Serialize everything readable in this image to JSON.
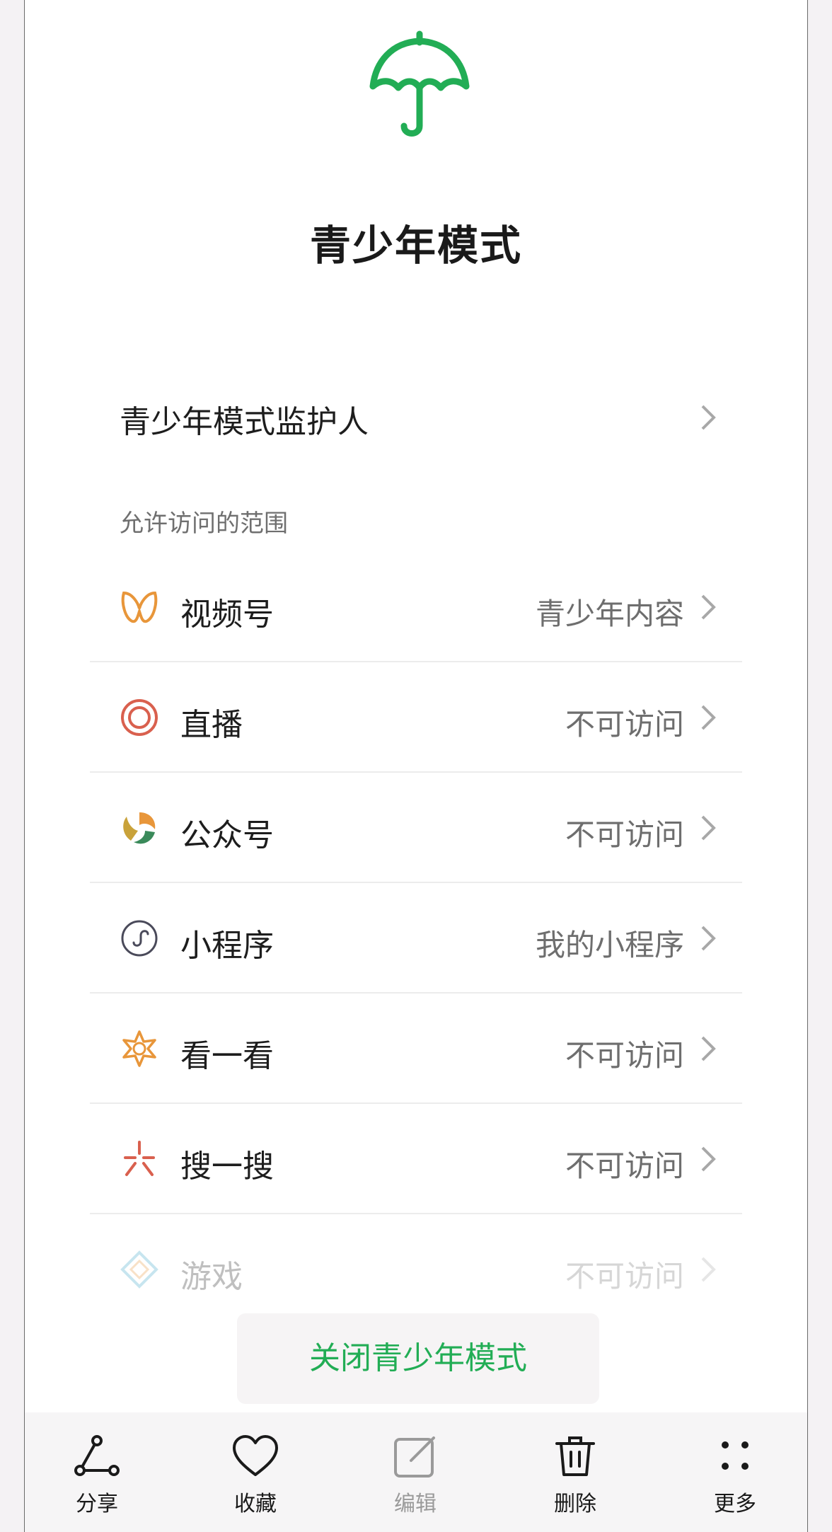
{
  "title": "青少年模式",
  "guardian": {
    "label": "青少年模式监护人"
  },
  "section_label": "允许访问的范围",
  "rows": [
    {
      "icon": "channels-butterfly-icon",
      "label": "视频号",
      "value": "青少年内容"
    },
    {
      "icon": "live-target-icon",
      "label": "直播",
      "value": "不可访问"
    },
    {
      "icon": "official-account-swirl-icon",
      "label": "公众号",
      "value": "不可访问"
    },
    {
      "icon": "mini-program-icon",
      "label": "小程序",
      "value": "我的小程序"
    },
    {
      "icon": "top-stories-star-icon",
      "label": "看一看",
      "value": "不可访问"
    },
    {
      "icon": "search-burst-icon",
      "label": "搜一搜",
      "value": "不可访问"
    },
    {
      "icon": "games-diamond-icon",
      "label": "游戏",
      "value": "不可访问"
    }
  ],
  "close_button": "关闭青少年模式",
  "toolbar": {
    "share": "分享",
    "favorite": "收藏",
    "edit": "编辑",
    "delete": "删除",
    "more": "更多"
  },
  "colors": {
    "accent_green": "#22ad55",
    "icon_orange": "#e8963a",
    "icon_red": "#d9604e"
  }
}
